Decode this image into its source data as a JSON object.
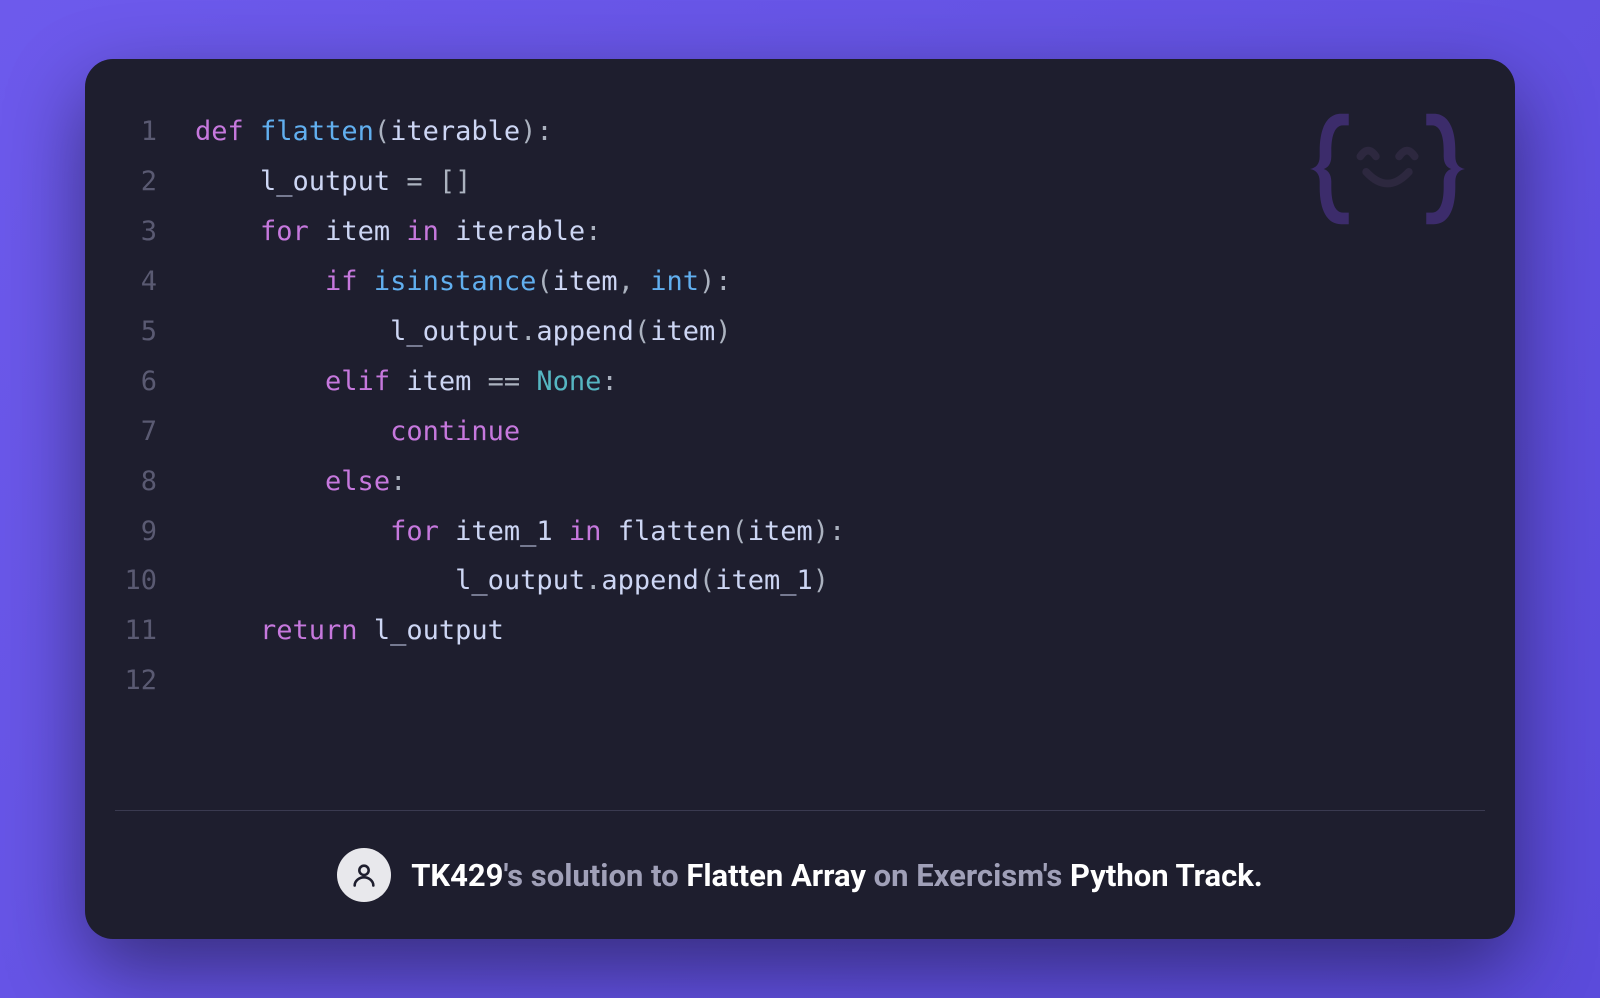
{
  "code": {
    "lines": [
      {
        "n": 1,
        "tokens": [
          {
            "t": "def",
            "c": "kw"
          },
          {
            "t": " ",
            "c": "nm"
          },
          {
            "t": "flatten",
            "c": "fn"
          },
          {
            "t": "(",
            "c": "pn"
          },
          {
            "t": "iterable",
            "c": "nm"
          },
          {
            "t": "):",
            "c": "pn"
          }
        ]
      },
      {
        "n": 2,
        "indent": 1,
        "tokens": [
          {
            "t": "l_output ",
            "c": "nm"
          },
          {
            "t": "=",
            "c": "pn"
          },
          {
            "t": " ",
            "c": "nm"
          },
          {
            "t": "[]",
            "c": "pn"
          }
        ]
      },
      {
        "n": 3,
        "indent": 1,
        "tokens": [
          {
            "t": "for",
            "c": "kw"
          },
          {
            "t": " item ",
            "c": "nm"
          },
          {
            "t": "in",
            "c": "kw"
          },
          {
            "t": " iterable",
            "c": "nm"
          },
          {
            "t": ":",
            "c": "pn"
          }
        ]
      },
      {
        "n": 4,
        "indent": 2,
        "tokens": [
          {
            "t": "if",
            "c": "kw"
          },
          {
            "t": " ",
            "c": "nm"
          },
          {
            "t": "isinstance",
            "c": "fn"
          },
          {
            "t": "(",
            "c": "pn"
          },
          {
            "t": "item",
            "c": "nm"
          },
          {
            "t": ",",
            "c": "pn"
          },
          {
            "t": " ",
            "c": "nm"
          },
          {
            "t": "int",
            "c": "fn"
          },
          {
            "t": "):",
            "c": "pn"
          }
        ]
      },
      {
        "n": 5,
        "indent": 3,
        "tokens": [
          {
            "t": "l_output",
            "c": "nm"
          },
          {
            "t": ".",
            "c": "pn"
          },
          {
            "t": "append",
            "c": "nm"
          },
          {
            "t": "(",
            "c": "pn"
          },
          {
            "t": "item",
            "c": "nm"
          },
          {
            "t": ")",
            "c": "pn"
          }
        ]
      },
      {
        "n": 6,
        "indent": 2,
        "tokens": [
          {
            "t": "elif",
            "c": "kw"
          },
          {
            "t": " item ",
            "c": "nm"
          },
          {
            "t": "==",
            "c": "pn"
          },
          {
            "t": " ",
            "c": "nm"
          },
          {
            "t": "None",
            "c": "lit"
          },
          {
            "t": ":",
            "c": "pn"
          }
        ]
      },
      {
        "n": 7,
        "indent": 3,
        "tokens": [
          {
            "t": "continue",
            "c": "kw"
          }
        ]
      },
      {
        "n": 8,
        "indent": 2,
        "tokens": [
          {
            "t": "else",
            "c": "kw"
          },
          {
            "t": ":",
            "c": "pn"
          }
        ]
      },
      {
        "n": 9,
        "indent": 3,
        "tokens": [
          {
            "t": "for",
            "c": "kw"
          },
          {
            "t": " item_1 ",
            "c": "nm"
          },
          {
            "t": "in",
            "c": "kw"
          },
          {
            "t": " ",
            "c": "nm"
          },
          {
            "t": "flatten",
            "c": "nm"
          },
          {
            "t": "(",
            "c": "pn"
          },
          {
            "t": "item",
            "c": "nm"
          },
          {
            "t": "):",
            "c": "pn"
          }
        ]
      },
      {
        "n": 10,
        "indent": 4,
        "tokens": [
          {
            "t": "l_output",
            "c": "nm"
          },
          {
            "t": ".",
            "c": "pn"
          },
          {
            "t": "append",
            "c": "nm"
          },
          {
            "t": "(",
            "c": "pn"
          },
          {
            "t": "item_1",
            "c": "nm"
          },
          {
            "t": ")",
            "c": "pn"
          }
        ]
      },
      {
        "n": 11,
        "indent": 1,
        "tokens": [
          {
            "t": "return",
            "c": "kw"
          },
          {
            "t": " l_output",
            "c": "nm"
          }
        ]
      },
      {
        "n": 12,
        "tokens": []
      }
    ]
  },
  "footer": {
    "user": "TK429",
    "possessive": "'s ",
    "solution_to": "solution to ",
    "exercise": "Flatten Array",
    "on_exercisms": " on Exercism's ",
    "track": "Python Track."
  }
}
